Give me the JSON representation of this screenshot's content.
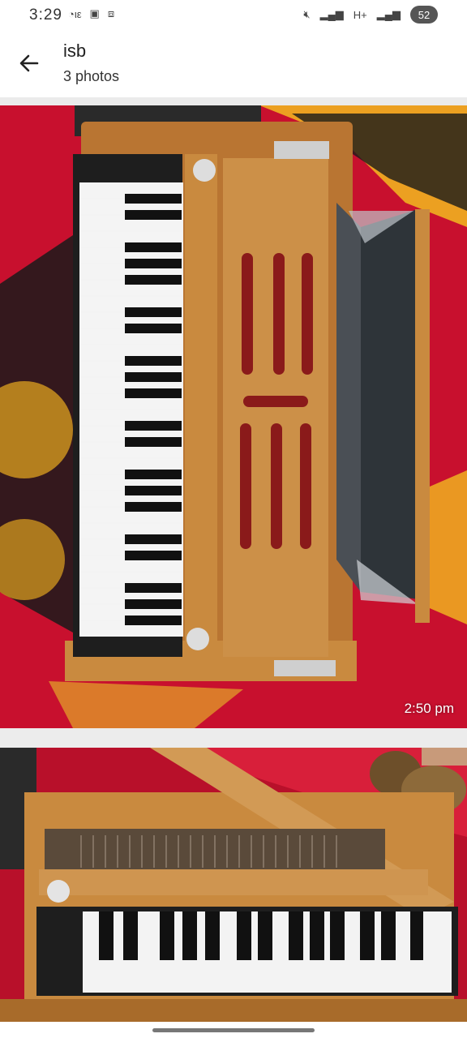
{
  "status_bar": {
    "time": "3:29",
    "battery": "52",
    "icons_left": [
      "volte-icon",
      "sim-data-icon",
      "screen-record-icon"
    ],
    "icons_right": [
      "mute-icon",
      "signal-icon",
      "lte-icon",
      "signal-icon-2",
      "battery-icon"
    ]
  },
  "header": {
    "title": "isb",
    "subtitle": "3 photos",
    "back_icon": "arrow-left-icon"
  },
  "photos": [
    {
      "caption": "",
      "timestamp": "2:50 pm"
    },
    {
      "caption": ""
    }
  ],
  "colors": {
    "background": "#ffffff",
    "carpet_red": "#c8102e",
    "wood": "#c98a3f",
    "key_black": "#111111",
    "key_white": "#f3f3f3"
  }
}
